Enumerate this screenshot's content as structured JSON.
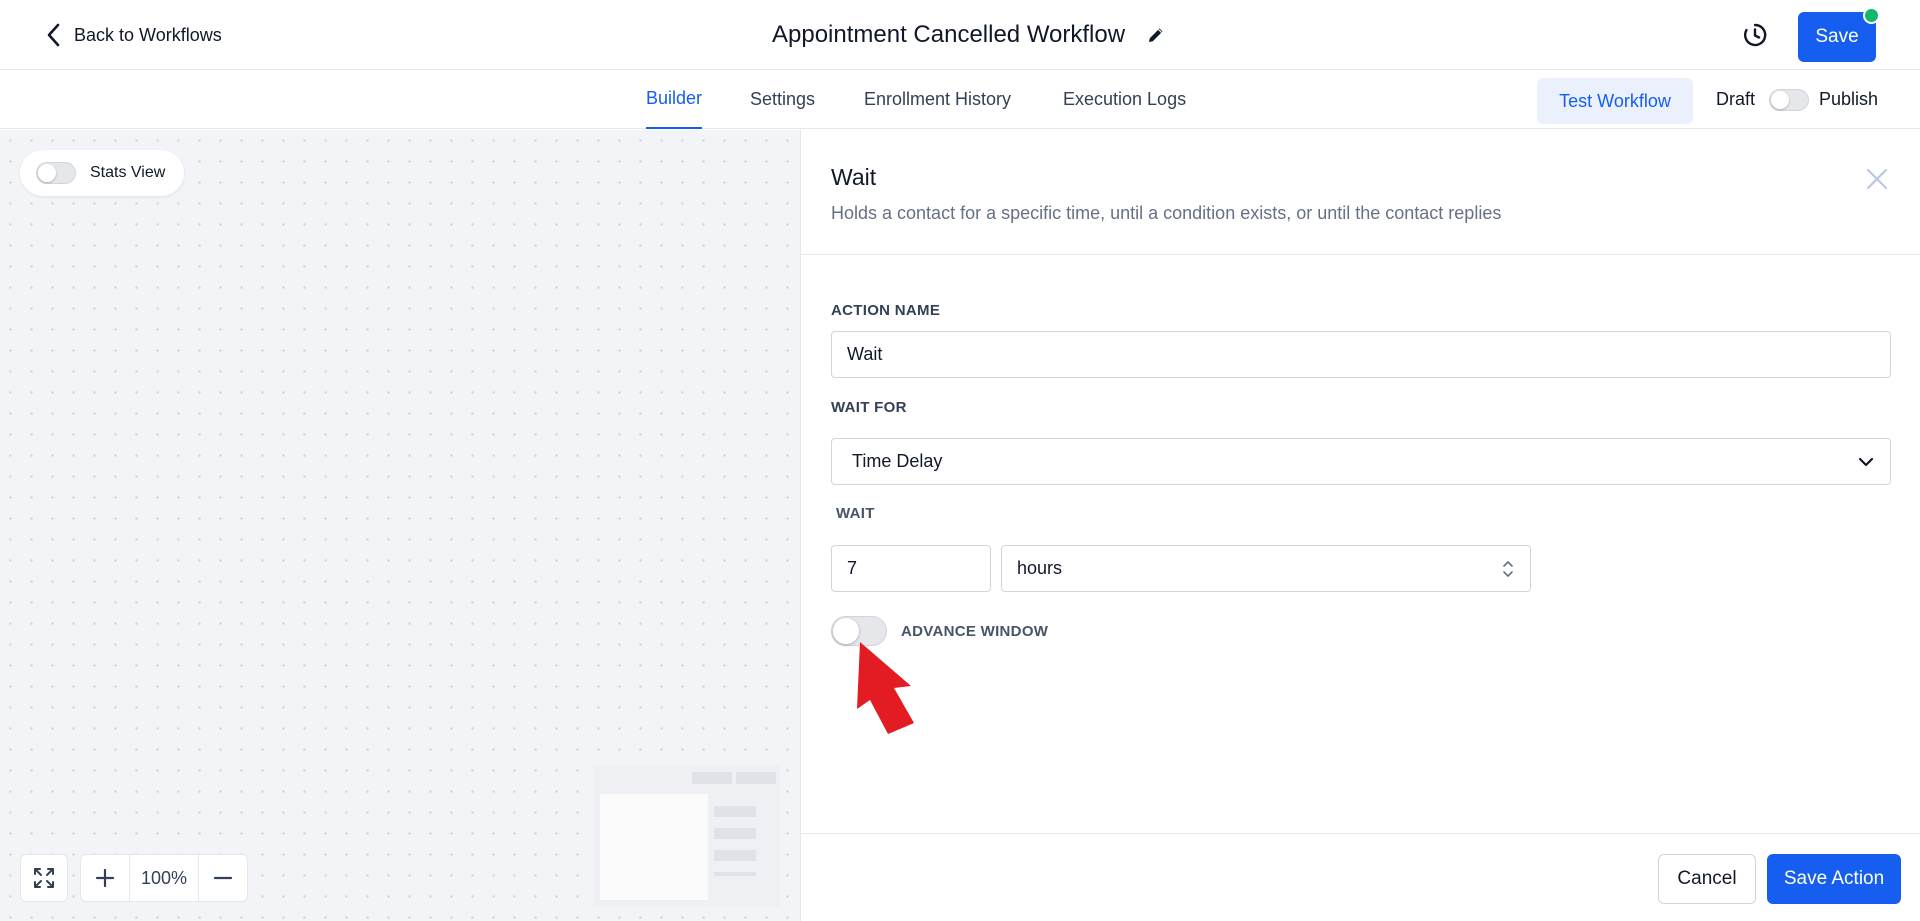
{
  "header": {
    "back_label": "Back to Workflows",
    "title": "Appointment Cancelled Workflow",
    "save_label": "Save",
    "status_dot_color": "#12b76a"
  },
  "tabs": [
    {
      "label": "Builder",
      "active": true
    },
    {
      "label": "Settings",
      "active": false
    },
    {
      "label": "Enrollment History",
      "active": false
    },
    {
      "label": "Execution Logs",
      "active": false
    }
  ],
  "toolbar": {
    "test_label": "Test Workflow",
    "draft_label": "Draft",
    "publish_label": "Publish",
    "publish_on": false
  },
  "canvas": {
    "stats_label": "Stats View",
    "stats_on": false,
    "zoom": "100%"
  },
  "panel": {
    "title": "Wait",
    "description": "Holds a contact for a specific time, until a condition exists, or until the contact replies",
    "action_name_label": "ACTION NAME",
    "action_name_value": "Wait",
    "wait_for_label": "WAIT FOR",
    "wait_for_value": "Time Delay",
    "wait_label": "WAIT",
    "wait_amount": "7",
    "wait_unit": "hours",
    "advance_window_label": "ADVANCE WINDOW",
    "advance_window_on": false,
    "cancel_label": "Cancel",
    "save_action_label": "Save Action"
  },
  "colors": {
    "accent": "#155eef",
    "annotation_arrow": "#e31b23"
  },
  "icons": [
    "chevron-left-icon",
    "pencil-icon",
    "history-icon",
    "close-icon",
    "chevron-down-icon",
    "up-down-chevron-icon",
    "fit-screen-icon",
    "plus-icon",
    "minus-icon"
  ]
}
